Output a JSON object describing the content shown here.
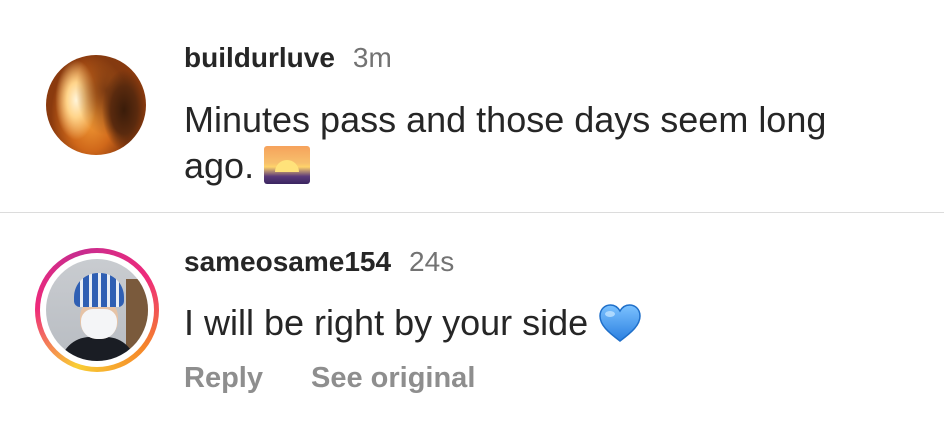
{
  "comments": [
    {
      "username": "buildurluve",
      "timestamp": "3m",
      "text": "Minutes pass and those days seem long ago.",
      "emoji": "sunrise-emoji",
      "avatar": "fiery-portrait-avatar",
      "story_ring": false
    },
    {
      "username": "sameosame154",
      "timestamp": "24s",
      "text": "I will be right by your side",
      "emoji": "blue-heart-emoji",
      "avatar": "masked-person-avatar",
      "story_ring": true,
      "actions": {
        "reply": "Reply",
        "see_original": "See original"
      }
    }
  ],
  "colors": {
    "username": "#262626",
    "secondary_text": "#737373",
    "action_text": "#8e8e8e",
    "divider": "#dcdcdc",
    "heart_blue": "#4ea0f0"
  }
}
